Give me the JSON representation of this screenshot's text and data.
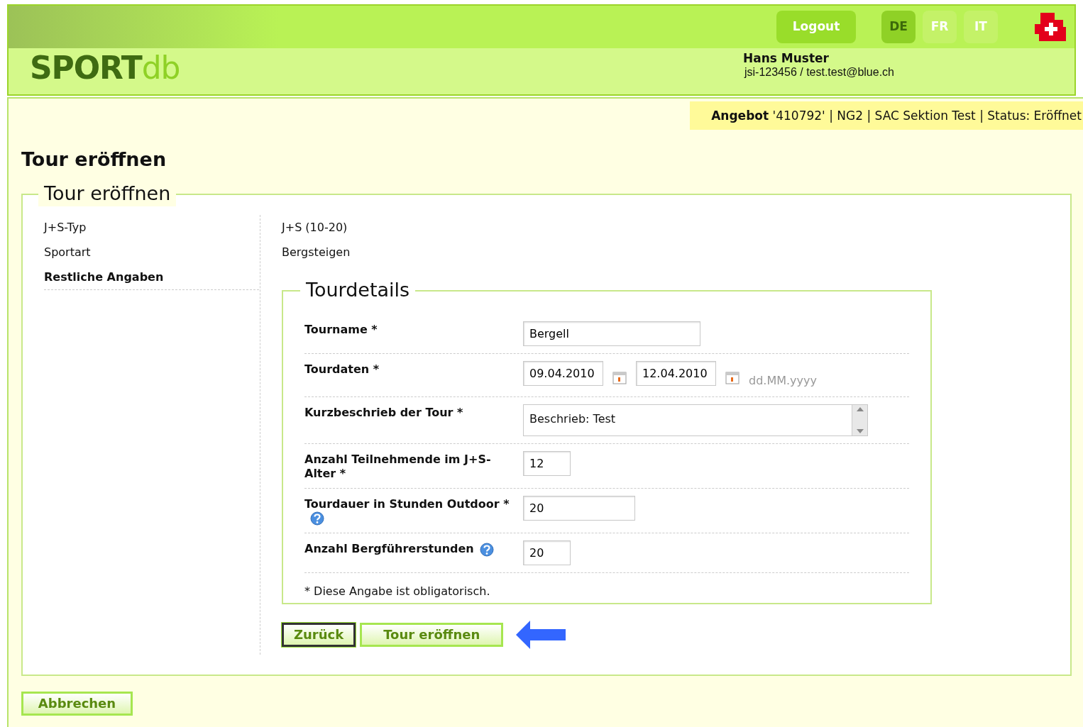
{
  "header": {
    "logo": {
      "main": "SPORT",
      "accent": "db"
    },
    "logout": "Logout",
    "languages": [
      {
        "label": "DE",
        "selected": true
      },
      {
        "label": "FR",
        "selected": false
      },
      {
        "label": "IT",
        "selected": false
      }
    ],
    "user_name": "Hans Muster",
    "user_info": "jsi-123456 / test.test@blue.ch"
  },
  "status_bar": "**Angebot** '410792' | NG2 | SAC Sektion Test | Status: Eröffnet",
  "page_title": "Tour eröffnen",
  "fieldset_title": "Tour eröffnen",
  "steps": [
    {
      "label": "J+S-Typ",
      "value": "J+S (10-20)",
      "selected": false
    },
    {
      "label": "Sportart",
      "value": "Bergsteigen",
      "selected": false
    },
    {
      "label": "Restliche Angaben",
      "selected": true
    }
  ],
  "tourdetails": {
    "title": "Tourdetails",
    "fields": [
      {
        "kind": "text",
        "label": "Tourname *",
        "value": "Bergell",
        "help": false
      },
      {
        "kind": "daterange",
        "label": "Tourdaten *",
        "from": "09.04.2010",
        "to": "12.04.2010",
        "format": "dd.MM.yyyy",
        "help": false
      },
      {
        "kind": "textarea",
        "label": "Kurzbeschrieb der Tour *",
        "value": "Beschrieb: Test",
        "help": false
      },
      {
        "kind": "text",
        "label": "Anzahl Teilnehmende im J+S-Alter *",
        "value": "12",
        "help": false
      },
      {
        "kind": "text",
        "label": "Tourdauer in Stunden Outdoor *",
        "value": "20",
        "help": true
      },
      {
        "kind": "text",
        "label": "Anzahl Bergführerstunden",
        "value": "20",
        "help": true
      }
    ],
    "note": "* Diese Angabe ist obligatorisch."
  },
  "buttons": [
    {
      "label": "Zurück",
      "focused": true
    },
    {
      "label": "Tour eröffnen",
      "focused": false
    }
  ],
  "cancel": "Abbrechen"
}
